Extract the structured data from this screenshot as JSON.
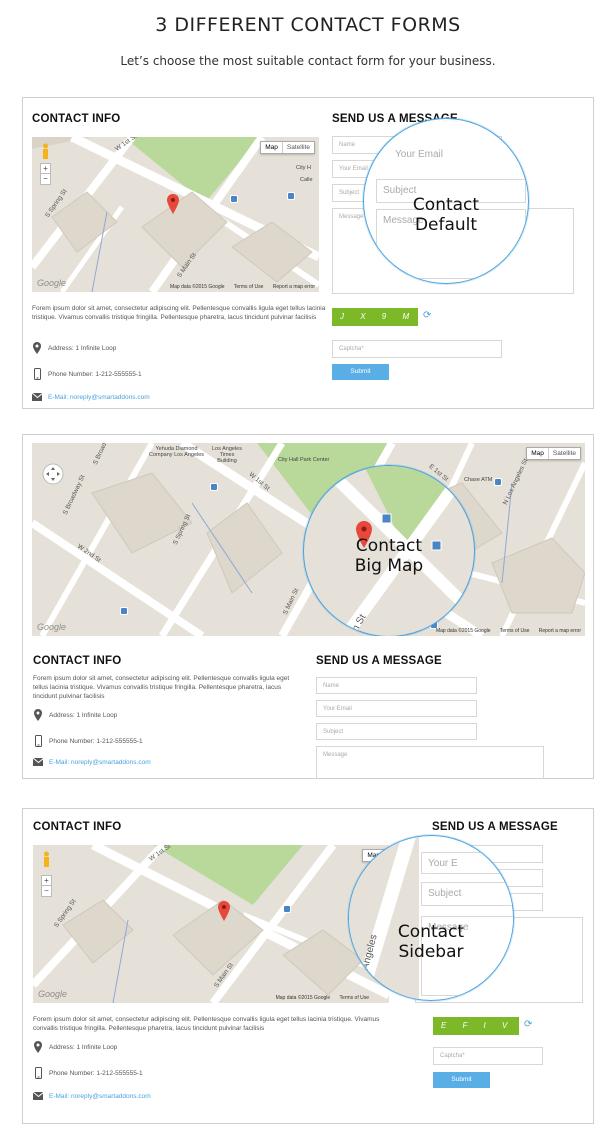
{
  "hero": {
    "title": "3 DIFFERENT CONTACT FORMS",
    "subtitle": "Let’s choose the most suitable contact form for your business."
  },
  "common": {
    "contact_info_heading": "CONTACT INFO",
    "send_message_heading": "SEND US A MESSAGE",
    "lorem": "Forem ipsum dolor sit amet, consectetur adipiscing elit. Pellentesque convallis ligula eget tellus lacinia tristique. Vivamus convallis tristique fringilla. Pellentesque pharetra, lacus tincidunt pulvinar facilisis",
    "address": "Address: 1 Infinite Loop",
    "phone": "Phone Number: 1-212-555555-1",
    "email": "E-Mail: noreply@smartaddons.com",
    "placeholder_name": "Name",
    "placeholder_email": "Your Email",
    "placeholder_subject": "Subject",
    "placeholder_message": "Message",
    "placeholder_captcha": "Captcha*",
    "submit_label": "Submit",
    "map_tab_map": "Map",
    "map_tab_satellite": "Satellite",
    "map_data": "Map data ©2015 Google",
    "terms": "Terms of Use",
    "report": "Report a map error",
    "google": "Google",
    "zoom_in": "+",
    "zoom_out": "−"
  },
  "form1": {
    "lens_line1": "Contact",
    "lens_line2": "Default",
    "lens_email": "Your Email",
    "lens_subject": "Subject",
    "lens_message": "Message",
    "captcha_text": "J X 9 M",
    "road_w1st": "W 1st St",
    "road_sspring": "S Spring St",
    "road_smain": "S Main St",
    "poi_calle": "Calle",
    "poi_cityhall": "City H"
  },
  "form2": {
    "lens_line1": "Contact",
    "lens_line2": "Big Map",
    "lens_road": "Main St",
    "poi_yehuda": "Yehuda Diamond\nCompany Los Angeles",
    "poi_latimes": "Los Angeles\nTimes\nBuilding",
    "poi_cityhallpark": "City Hall Park Center",
    "poi_chase": "Chase ATM",
    "road_sbroadway": "S Broadway St",
    "road_w2nd": "W 2nd St",
    "road_sspring": "S Spring St",
    "road_w1st": "W 1st St",
    "road_smain": "S Main St",
    "road_nlosangeles": "N Los Angeles St",
    "road_sbrd": "S Broadw",
    "road_e1st": "E 1st St"
  },
  "form3": {
    "lens_line1": "Contact",
    "lens_line2": "Sidebar",
    "lens_email": "Your E",
    "lens_subject": "Subject",
    "lens_message": "Message",
    "lens_road": "Los Angeles",
    "captcha_text": "E F I V E",
    "road_w1st": "W 1st St",
    "road_sspring": "S Spring St",
    "road_smain": "S Main St"
  }
}
